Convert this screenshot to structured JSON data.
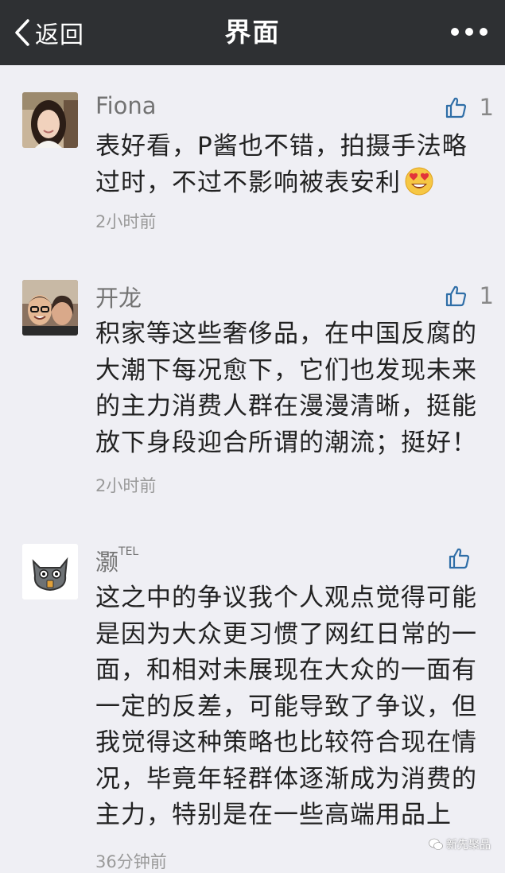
{
  "nav": {
    "back_label": "返回",
    "title": "界面"
  },
  "comments": [
    {
      "nickname": "Fiona",
      "nickname_sup": "",
      "like_count": "1",
      "lines": [
        "表好看，P酱也不错，拍摄手法略",
        "过时，不过不影响被表安利"
      ],
      "emoji": "heart-eyes-emoji",
      "time": "2小时前"
    },
    {
      "nickname": "开龙",
      "nickname_sup": "",
      "like_count": "1",
      "lines": [
        "积家等这些奢侈品，在中国反腐的",
        "大潮下每况愈下，它们也发现未来",
        "的主力消费人群在漫漫清晰，挺能",
        "放下身段迎合所谓的潮流；挺好！"
      ],
      "time": "2小时前"
    },
    {
      "nickname": "灏",
      "nickname_sup": "TEL",
      "like_count": "",
      "lines": [
        "这之中的争议我个人观点觉得可能",
        "是因为大众更习惯了网红日常的一",
        "面，和相对未展现在大众的一面有",
        "一定的反差，可能导致了争议，但",
        "我觉得这种策略也比较符合现在情",
        "况，毕竟年轻群体逐渐成为消费的",
        "主力，特别是在一些高端用品上"
      ],
      "time": "36分钟前"
    }
  ],
  "watermark": {
    "text": "新先聚品"
  },
  "colors": {
    "navbar_bg": "#2e3033",
    "page_bg": "#efeff4",
    "like_icon": "#2f6ea7",
    "nickname": "#737373",
    "time": "#9a9a9a"
  }
}
